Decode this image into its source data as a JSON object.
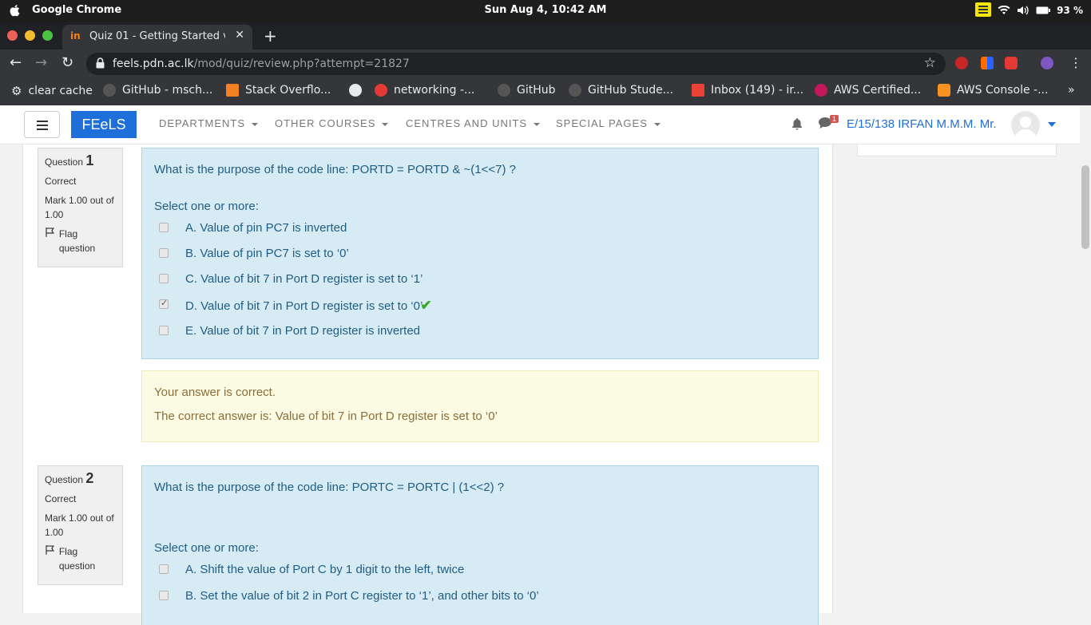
{
  "os": {
    "app_name": "Google Chrome",
    "clock": "Sun Aug  4, 10:42 AM",
    "battery": "93 %"
  },
  "browser": {
    "tab_title": "Quiz 01 - Getting Started v",
    "tab_favicon_text": "in",
    "url_host": "feels.pdn.ac.lk",
    "url_path": "/mod/quiz/review.php?attempt=21827",
    "bookmarks": [
      {
        "label": "clear cache"
      },
      {
        "label": "GitHub - msch..."
      },
      {
        "label": "Stack Overflo..."
      },
      {
        "label": ""
      },
      {
        "label": "networking -..."
      },
      {
        "label": "GitHub"
      },
      {
        "label": "GitHub Stude..."
      },
      {
        "label": "Inbox (149) - ir..."
      },
      {
        "label": "AWS Certified..."
      },
      {
        "label": "AWS Console -..."
      }
    ],
    "more_bookmarks": "»"
  },
  "navbar": {
    "brand": "FEeLS",
    "menu": [
      "DEPARTMENTS",
      "OTHER COURSES",
      "CENTRES AND UNITS",
      "SPECIAL PAGES"
    ],
    "message_badge": "1",
    "user": "E/15/138 IRFAN M.M.M. Mr."
  },
  "questions": [
    {
      "label": "Question",
      "number": "1",
      "state": "Correct",
      "mark": "Mark 1.00 out of 1.00",
      "flag": "Flag question",
      "text": "What is the purpose of the code line: PORTD = PORTD & ~(1<<7) ?",
      "prompt": "Select one or more:",
      "options": [
        {
          "label": "A. Value of pin PC7 is inverted",
          "checked": false
        },
        {
          "label": "B. Value of pin PC7 is set to ‘0’",
          "checked": false
        },
        {
          "label": "C. Value of bit 7 in Port D register is set to ‘1’",
          "checked": false
        },
        {
          "label": "D. Value of bit 7 in Port D register is set to ‘0’",
          "checked": true
        },
        {
          "label": "E. Value of bit 7 in Port D register is inverted",
          "checked": false
        }
      ],
      "feedback_status": "Your answer is correct.",
      "feedback_answer": "The correct answer is: Value of bit 7 in Port D register is set to ‘0’"
    },
    {
      "label": "Question",
      "number": "2",
      "state": "Correct",
      "mark": "Mark 1.00 out of 1.00",
      "flag": "Flag question",
      "text": "What is the purpose of the code line: PORTC = PORTC | (1<<2) ?",
      "prompt": "Select one or more:",
      "options": [
        {
          "label": "A. Shift the value of Port C by 1 digit to the left, twice",
          "checked": false
        },
        {
          "label": "B. Set the value of bit 2 in Port C register to ‘1’, and other bits to ‘0’",
          "checked": false
        }
      ]
    }
  ]
}
